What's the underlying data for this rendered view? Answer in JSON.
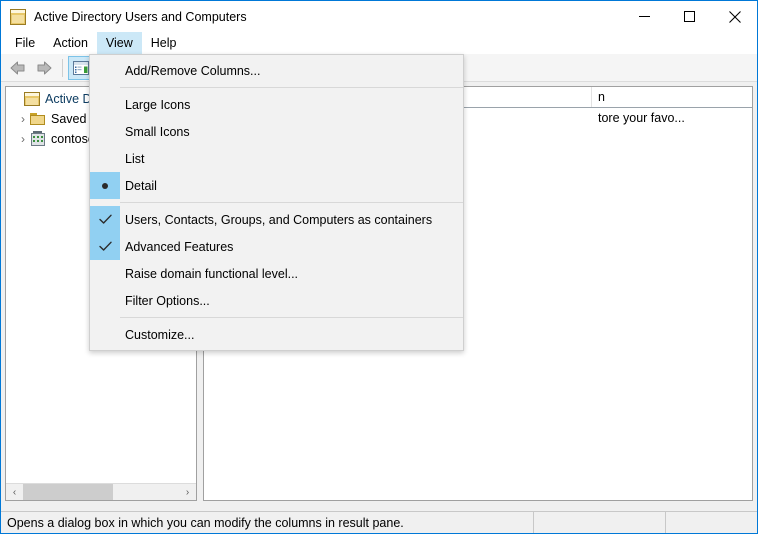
{
  "window": {
    "title": "Active Directory Users and Computers",
    "icon": "console-icon",
    "minimize_label": "—",
    "maximize_label": "□",
    "close_label": "✕"
  },
  "menubar": {
    "items": [
      {
        "label": "File",
        "open": false
      },
      {
        "label": "Action",
        "open": false
      },
      {
        "label": "View",
        "open": true
      },
      {
        "label": "Help",
        "open": false
      }
    ]
  },
  "toolbar": {
    "back_label": "Back",
    "forward_label": "Forward",
    "show_tree_label": "Show/Hide Console Tree"
  },
  "tree": {
    "items": [
      {
        "label": "Active Direc",
        "expander": "",
        "icon": "console-icon",
        "indent": 0,
        "root": true
      },
      {
        "label": "Saved Q",
        "expander": "›",
        "icon": "folder-icon",
        "indent": 1,
        "root": false
      },
      {
        "label": "contoso",
        "expander": "›",
        "icon": "domain-icon",
        "indent": 1,
        "root": false
      }
    ],
    "scrollbar": {
      "left_arrow": "‹",
      "right_arrow": "›"
    }
  },
  "result": {
    "columns": [
      "",
      "",
      "n"
    ],
    "rows": [
      {
        "name": "",
        "type": "",
        "description": "tore your favo..."
      }
    ]
  },
  "view_menu": {
    "groups": [
      {
        "items": [
          {
            "label": "Add/Remove Columns...",
            "mark": "none"
          }
        ]
      },
      {
        "items": [
          {
            "label": "Large Icons",
            "mark": "none"
          },
          {
            "label": "Small Icons",
            "mark": "none"
          },
          {
            "label": "List",
            "mark": "none"
          },
          {
            "label": "Detail",
            "mark": "radio"
          }
        ]
      },
      {
        "items": [
          {
            "label": "Users, Contacts, Groups, and Computers as containers",
            "mark": "check"
          },
          {
            "label": "Advanced Features",
            "mark": "check"
          },
          {
            "label": "Raise domain functional level...",
            "mark": "none"
          },
          {
            "label": "Filter Options...",
            "mark": "none"
          }
        ]
      },
      {
        "items": [
          {
            "label": "Customize...",
            "mark": "none"
          }
        ]
      }
    ]
  },
  "statusbar": {
    "message": "Opens a dialog box in which you can modify the columns in result pane.",
    "panel2": "",
    "panel3": ""
  },
  "colors": {
    "accent": "#0078d7",
    "menu_highlight": "#cce8f7",
    "mark_highlight": "#91d0f2",
    "menu_bg": "#f2f2f2"
  }
}
